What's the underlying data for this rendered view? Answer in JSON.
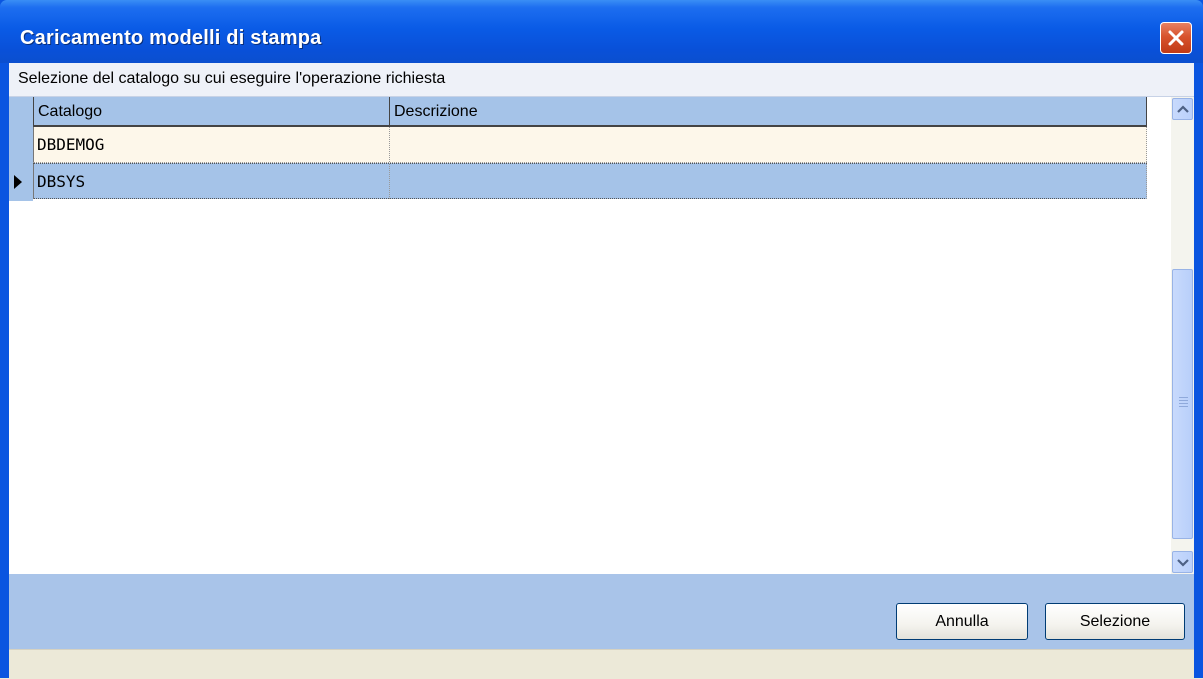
{
  "window": {
    "title": "Caricamento modelli di stampa"
  },
  "caption": "Selezione del catalogo su cui eseguire l'operazione richiesta",
  "grid": {
    "columns": [
      "Catalogo",
      "Descrizione"
    ],
    "rows": [
      {
        "catalogo": "DBDEMOG",
        "descrizione": ""
      },
      {
        "catalogo": "DBSYS",
        "descrizione": "",
        "selected": true
      }
    ]
  },
  "buttons": {
    "cancel": "Annulla",
    "select": "Selezione"
  },
  "icons": {
    "close": "close-icon",
    "scroll_up": "chevron-up-icon",
    "scroll_down": "chevron-down-icon",
    "row_indicator": "row-pointer-icon"
  },
  "colors": {
    "titlebar": "#0a5be6",
    "grid_header": "#a5c3e8",
    "selected_row": "#a5c3e8",
    "unselected_row": "#fdf7ea",
    "footer": "#a9c4e9"
  }
}
